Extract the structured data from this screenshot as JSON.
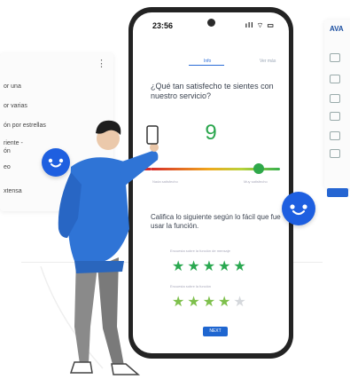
{
  "left_panel": {
    "options": [
      "or una",
      "or varias",
      "ón por estrellas",
      "riente -",
      "ón",
      "eo",
      "xtensa"
    ]
  },
  "right_panel": {
    "title": "AVA",
    "icons": [
      "text-icon",
      "tag-icon",
      "people-icon",
      "image-icon",
      "document-icon",
      "grid-icon"
    ]
  },
  "phone": {
    "status_time": "23:56",
    "status_icons": "ıll ⌔ ▭",
    "tabs": [
      "Info",
      "Ver más"
    ],
    "question": "¿Qué tan satisfecho te sientes con nuestro servicio?",
    "score": "9",
    "slider": {
      "value_fraction": 0.9,
      "low_label": "Nada satisfecho",
      "high_label": "Muy satisfecho"
    },
    "question2": "Califica lo siguiente según lo fácil que fue usar la función.",
    "rating1": {
      "label": "Encuesta sobre la función de mensaje",
      "stars_filled": 5,
      "stars_total": 5
    },
    "rating2": {
      "label": "Encuesta sobre la función",
      "stars_filled": 4,
      "stars_total": 5
    },
    "next_label": "NEXT"
  },
  "colors": {
    "accent_blue": "#1e5fe0",
    "star_green": "#2aa850",
    "score_green": "#2aa64d",
    "person_hoodie": "#2f74d6"
  }
}
